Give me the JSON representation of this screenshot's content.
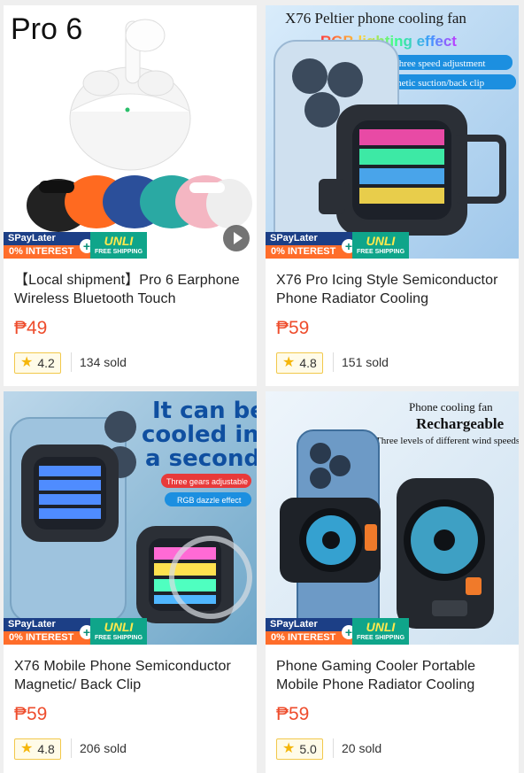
{
  "promo": {
    "spaylater": "SPayLater",
    "zero_interest": "0% INTEREST",
    "unli": "UNLI",
    "free_shipping": "FREE SHIPPING",
    "colors": {
      "spay": "#1c3f86",
      "interest": "#ff6d2a",
      "unli": "#0fa58a",
      "price": "#ee4d2d"
    }
  },
  "products": [
    {
      "image_text": {
        "headline": "Pro 6"
      },
      "title": "【Local shipment】Pro 6 Earphone Wireless Bluetooth Touch",
      "price": "₱49",
      "rating": "4.2",
      "sold": "134 sold"
    },
    {
      "image_text": {
        "headline": "X76 Peltier phone cooling fan",
        "subheadline": "RGB lighting effect",
        "tag1": "Three speed adjustment",
        "tag2": "Magnetic suction/back clip"
      },
      "title": "X76 Pro Icing Style Semiconductor Phone Radiator Cooling",
      "price": "₱59",
      "rating": "4.8",
      "sold": "151 sold"
    },
    {
      "image_text": {
        "line1": "It can be",
        "line2": "cooled in",
        "line3": "a second",
        "tag1": "Three gears adjustable",
        "tag2": "RGB dazzle effect"
      },
      "title": "X76 Mobile Phone Semiconductor Magnetic/ Back Clip",
      "price": "₱59",
      "rating": "4.8",
      "sold": "206 sold"
    },
    {
      "image_text": {
        "line1": "Phone cooling fan",
        "line2": "Rechargeable",
        "line3": "Three levels of different wind speeds"
      },
      "title": "Phone Gaming Cooler Portable Mobile Phone Radiator Cooling",
      "price": "₱59",
      "rating": "5.0",
      "sold": "20 sold"
    }
  ]
}
